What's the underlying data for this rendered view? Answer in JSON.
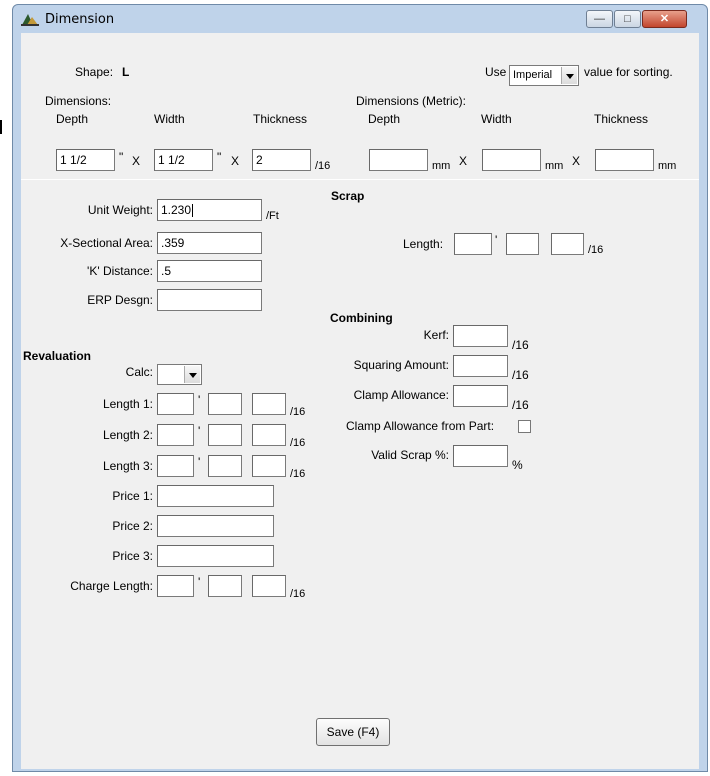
{
  "window": {
    "title": "Dimension",
    "min_label": "—",
    "max_label": "□",
    "close_label": "✕"
  },
  "top": {
    "shape_label": "Shape:",
    "shape_value": "L",
    "use_label": "Use",
    "sort_option": "Imperial",
    "sort_suffix": "value for sorting.",
    "dims_label": "Dimensions:",
    "dims_metric_label": "Dimensions (Metric):",
    "col_depth": "Depth",
    "col_width": "Width",
    "col_thickness": "Thickness",
    "col_m_depth": "Depth",
    "col_m_width": "Width",
    "col_m_thickness": "Thickness",
    "depth_value": "1 1/2",
    "width_value": "1 1/2",
    "thickness_value": "2",
    "inch_mark": "\"",
    "x_sep": "X",
    "sixteenth": "/16",
    "mm": "mm"
  },
  "scrap": {
    "title": "Scrap",
    "length_label": "Length:",
    "foot_mark": "'",
    "sixteenth": "/16"
  },
  "props": {
    "unit_weight_label": "Unit Weight:",
    "unit_weight_value": "1.230",
    "per_ft": "/Ft",
    "xsec_label": "X-Sectional Area:",
    "xsec_value": ".359",
    "k_label": "'K' Distance:",
    "k_value": ".5",
    "erp_label": "ERP Desgn:",
    "erp_value": ""
  },
  "combining": {
    "title": "Combining",
    "kerf_label": "Kerf:",
    "squaring_label": "Squaring Amount:",
    "clamp_label": "Clamp Allowance:",
    "clamp_part_label": "Clamp Allowance from Part:",
    "valid_scrap_label": "Valid Scrap %:",
    "sixteenth": "/16",
    "percent": "%"
  },
  "revaluation": {
    "title": "Revaluation",
    "calc_label": "Calc:",
    "length1_label": "Length 1:",
    "length2_label": "Length 2:",
    "length3_label": "Length 3:",
    "price1_label": "Price 1:",
    "price2_label": "Price 2:",
    "price3_label": "Price 3:",
    "charge_label": "Charge Length:",
    "foot_mark": "'",
    "sixteenth": "/16"
  },
  "actions": {
    "save_label": "Save (F4)"
  }
}
